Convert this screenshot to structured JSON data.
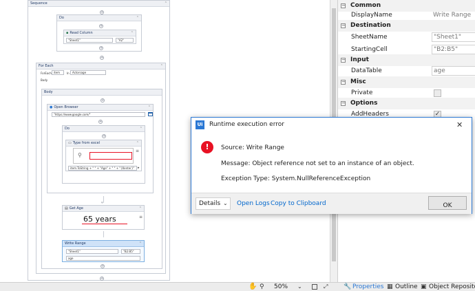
{
  "workflow": {
    "sequence_title": "Sequence",
    "do_title": "Do",
    "read_column": {
      "title": "Read Column",
      "sheet": "\"Sheet1\"",
      "cell": "\"A2\""
    },
    "for_each": {
      "title": "For Each",
      "foreach_label": "ForEach",
      "item": "item",
      "in_label": "In",
      "collection": "Actorsage",
      "body_label": "Body"
    },
    "body_title": "Body",
    "open_browser": {
      "title": "Open Browser",
      "url": "\"https://www.google.com/\""
    },
    "inner_do_title": "Do",
    "type_from_excel": {
      "title": "Type from excel",
      "expression": "item.ToString + \" \" + \"Age\" + \" \" + \"{Kenter}\""
    },
    "get_age": {
      "title": "Get Age",
      "preview_text": "65 years"
    },
    "write_range": {
      "title": "Write Range",
      "sheet": "\"Sheet1\"",
      "cell": "\"B2:B5\"",
      "datatable": "age"
    }
  },
  "properties": {
    "categories": {
      "common": "Common",
      "destination": "Destination",
      "input": "Input",
      "misc": "Misc",
      "options": "Options"
    },
    "display_name": {
      "label": "DisplayName",
      "value": "Write Range"
    },
    "sheet_name": {
      "label": "SheetName",
      "value": "\"Sheet1\""
    },
    "starting_cell": {
      "label": "StartingCell",
      "value": "\"B2:B5\""
    },
    "data_table": {
      "label": "DataTable",
      "value": "age"
    },
    "private": {
      "label": "Private"
    },
    "add_headers": {
      "label": "AddHeaders",
      "check": "✓"
    }
  },
  "dialog": {
    "app_icon": "Ui",
    "title": "Runtime execution error",
    "error_icon": "!",
    "source": "Source: Write Range",
    "message": "Message: Object reference not set to an instance of an object.",
    "exception": "Exception Type: System.NullReferenceException",
    "details_label": "Details",
    "open_logs": "Open Logs",
    "copy_clipboard": "Copy to Clipboard",
    "ok_label": "OK",
    "close_glyph": "✕"
  },
  "statusbar": {
    "zoom": "50%",
    "properties_tab": "Properties",
    "outline_tab": "Outline",
    "object_repo_tab": "Object Repositor"
  },
  "colors": {
    "accent": "#2b78d4",
    "error": "#e81123",
    "link": "#0066cc",
    "header": "#1f3864"
  }
}
